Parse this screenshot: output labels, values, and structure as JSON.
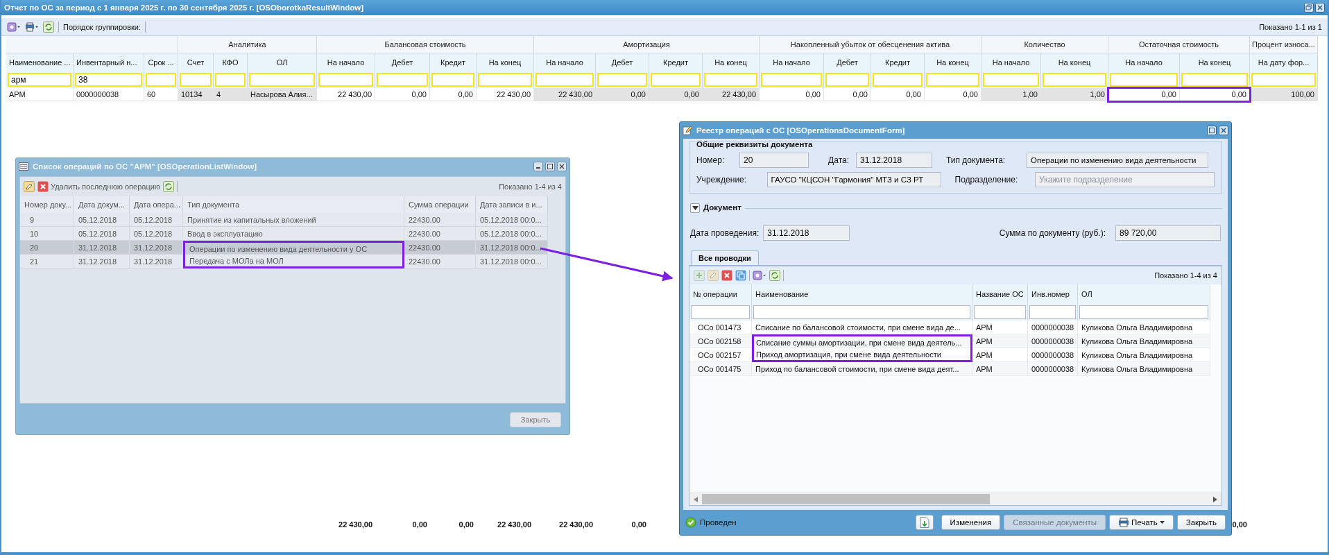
{
  "main_window": {
    "title": "Отчет по ОС за период с 1 января 2025 г. по 30 сентября 2025 г. [OSOborotkaResultWindow]",
    "toolbar": {
      "grouping_label": "Порядок группировки:",
      "paging": "Показано 1-1 из 1"
    },
    "table": {
      "groups": [
        {
          "columns": [
            {
              "label": "Наименование ...",
              "filter": "арм"
            },
            {
              "label": "Инвентарный н...",
              "filter": "38"
            },
            {
              "label": "Срок ..."
            }
          ]
        },
        {
          "label": "Аналитика",
          "columns": [
            {
              "label": "Счет"
            },
            {
              "label": "КФО"
            },
            {
              "label": "ОЛ"
            }
          ]
        },
        {
          "label": "Балансовая стоимость",
          "columns": [
            {
              "label": "На начало",
              "total": "22 430,00"
            },
            {
              "label": "Дебет",
              "total": "0,00"
            },
            {
              "label": "Кредит",
              "total": "0,00"
            },
            {
              "label": "На конец",
              "total": "22 430,00"
            }
          ]
        },
        {
          "label": "Амортизация",
          "columns": [
            {
              "label": "На начало",
              "total": "22 430,00"
            },
            {
              "label": "Дебет",
              "total": "0,00"
            },
            {
              "label": "Кредит"
            },
            {
              "label": "На конец"
            }
          ]
        },
        {
          "label": "Накопленный убыток от обесценения актива",
          "columns": [
            {
              "label": "На начало"
            },
            {
              "label": "Дебет"
            },
            {
              "label": "Кредит"
            },
            {
              "label": "На конец"
            }
          ]
        },
        {
          "label": "Количество",
          "columns": [
            {
              "label": "На начало"
            },
            {
              "label": "На конец"
            }
          ]
        },
        {
          "label": "Остаточная стоимость",
          "highlighted": true,
          "columns": [
            {
              "label": "На начало"
            },
            {
              "label": "На конец",
              "total": "0,00"
            }
          ]
        },
        {
          "label": "Процент износа...",
          "columns": [
            {
              "label": "На дату фор..."
            }
          ]
        }
      ],
      "rows": [
        {
          "cells": [
            "АРМ",
            "0000000038",
            "60",
            "10134",
            "4",
            "Насырова Алия...",
            "22 430,00",
            "0,00",
            "0,00",
            "22 430,00",
            "22 430,00",
            "0,00",
            "0,00",
            "22 430,00",
            "0,00",
            "0,00",
            "0,00",
            "0,00",
            "1,00",
            "1,00",
            "0,00",
            "0,00",
            "100,00"
          ]
        }
      ]
    }
  },
  "operations_window": {
    "title": "Список операций по ОС \"АРМ\" [OSOperationListWindow]",
    "active": false,
    "toolbar": {
      "delete_label": "Удалить последнюю операцию",
      "paging": "Показано 1-4 из 4"
    },
    "columns": [
      "Номер доку...",
      "Дата докум...",
      "Дата опера...",
      "Тип документа",
      "Сумма операции",
      "Дата записи в и..."
    ],
    "rows": [
      {
        "cells": [
          "9",
          "05.12.2018",
          "05.12.2018",
          "Принятие из капитальных вложений",
          "22430.00",
          "05.12.2018 00:0..."
        ],
        "selected": false,
        "highlighted": false
      },
      {
        "cells": [
          "10",
          "05.12.2018",
          "05.12.2018",
          "Ввод в эксплуатацию",
          "22430.00",
          "05.12.2018 00:0..."
        ],
        "selected": false,
        "highlighted": false
      },
      {
        "cells": [
          "20",
          "31.12.2018",
          "31.12.2018",
          "Операции по изменению вида деятельности у ОС",
          "22430.00",
          "31.12.2018 00:0..."
        ],
        "selected": true,
        "highlighted": true
      },
      {
        "cells": [
          "21",
          "31.12.2018",
          "31.12.2018",
          "Передача с МОЛа на МОЛ",
          "22430.00",
          "31.12.2018 00:0..."
        ],
        "selected": false,
        "highlighted": true
      }
    ],
    "close_label": "Закрыть"
  },
  "document_window": {
    "title": "Реестр операций с ОС [OSOperationsDocumentForm]",
    "active": true,
    "requisites": {
      "legend": "Общие реквизиты документа",
      "number_label": "Номер:",
      "number": "20",
      "date_label": "Дата:",
      "date": "31.12.2018",
      "type_label": "Тип документа:",
      "type": "Операции по изменению вида деятельности",
      "org_label": "Учреждение:",
      "org": "ГАУСО \"КЦСОН \"Гармония\" МТЗ и СЗ РТ",
      "division_label": "Подразделение:",
      "division_placeholder": "Укажите подразделение"
    },
    "document": {
      "legend": "Документ",
      "expanded": true,
      "posting_date_label": "Дата проведения:",
      "posting_date": "31.12.2018",
      "sum_label": "Сумма по документу (руб.):",
      "sum": "89 720,00"
    },
    "tabs": [
      {
        "label": "Все проводки",
        "selected": true
      }
    ],
    "grid": {
      "paging": "Показано 1-4 из 4",
      "columns": [
        "№ операции",
        "Наименование",
        "Название ОС",
        "Инв.номер",
        "ОЛ"
      ],
      "rows": [
        {
          "cells": [
            "ОСо 001473",
            "Списание по балансовой стоимости, при смене вида де...",
            "АРМ",
            "0000000038",
            "Куликова Ольга Владимировна"
          ],
          "highlighted": false
        },
        {
          "cells": [
            "ОСо 002158",
            "Списание суммы амортизации, при смене вида деятель...",
            "АРМ",
            "0000000038",
            "Куликова Ольга Владимировна"
          ],
          "highlighted": true
        },
        {
          "cells": [
            "ОСо 002157",
            "Приход амортизация, при смене вида деятельности",
            "АРМ",
            "0000000038",
            "Куликова Ольга Владимировна"
          ],
          "highlighted": true
        },
        {
          "cells": [
            "ОСо 001475",
            "Приход по балансовой стоимости, при смене вида деят...",
            "АРМ",
            "0000000038",
            "Куликова Ольга Владимировна"
          ],
          "highlighted": false
        }
      ]
    },
    "status": "Проведен",
    "buttons": [
      {
        "label": "Изменения",
        "disabled": false,
        "dropdown": false
      },
      {
        "label": "Связанные документы",
        "disabled": true,
        "dropdown": false
      },
      {
        "label": "Печать",
        "disabled": false,
        "dropdown": true
      },
      {
        "label": "Закрыть",
        "disabled": false,
        "dropdown": false
      }
    ]
  }
}
